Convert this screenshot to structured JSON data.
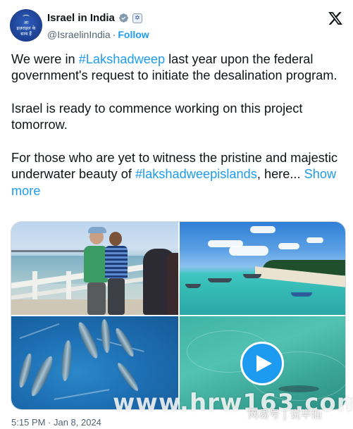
{
  "author": {
    "avatar_text": [
      "आ",
      "इज़राइल के",
      "साथ हैं"
    ],
    "display_name": "Israel in India",
    "handle": "@IsraelinIndia",
    "separator": "·",
    "follow_label": "Follow"
  },
  "icons": {
    "verified": "verified-badge-icon",
    "affiliate": "government-badge-icon",
    "platform": "x-logo-icon",
    "play": "play-icon"
  },
  "tweet": {
    "p1_a": "We were in ",
    "p1_tag": "#Lakshadweep",
    "p1_b": " last year upon the federal government's request to initiate the desalination program.",
    "p2": "Israel is ready to commence working on this project tomorrow.",
    "p3_a": "For those who are yet to witness the pristine and majestic underwater beauty of ",
    "p3_tag": "#lakshadweepislands",
    "p3_b": ", here...",
    "show_more": "Show more"
  },
  "footer": {
    "timestamp": "5:15 PM · Jan 8, 2024"
  },
  "watermark": {
    "url": "www.hrw163.com",
    "brand": "网易号 | 说半仙"
  },
  "colors": {
    "link": "#1d9bf0",
    "text": "#0f1419",
    "muted": "#536471"
  }
}
